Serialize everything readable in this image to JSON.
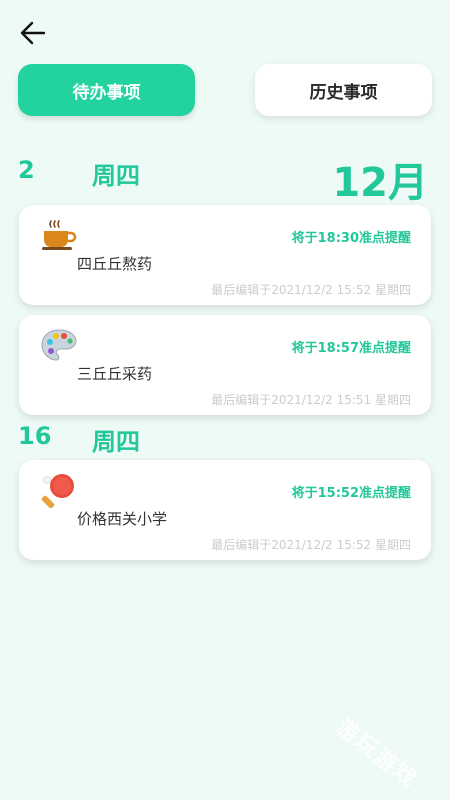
{
  "tabs": {
    "active_label": "待办事项",
    "inactive_label": "历史事项"
  },
  "month_label": "12月",
  "groups": [
    {
      "day": "2",
      "weekday": "周四",
      "items": [
        {
          "icon": "coffee-cup-icon",
          "remind": "将于18:30准点提醒",
          "title": "四丘丘熬药",
          "edited": "最后编辑于2021/12/2 15:52 星期四"
        },
        {
          "icon": "paint-palette-icon",
          "remind": "将于18:57准点提醒",
          "title": "三丘丘采药",
          "edited": "最后编辑于2021/12/2 15:51 星期四"
        }
      ]
    },
    {
      "day": "16",
      "weekday": "周四",
      "items": [
        {
          "icon": "ping-pong-paddle-icon",
          "remind": "将于15:52准点提醒",
          "title": "价格西关小学",
          "edited": "最后编辑于2021/12/2 15:52 星期四"
        }
      ]
    }
  ],
  "watermark": "游玩游戏",
  "colors": {
    "accent": "#22c79a",
    "background": "#eefaf5"
  }
}
